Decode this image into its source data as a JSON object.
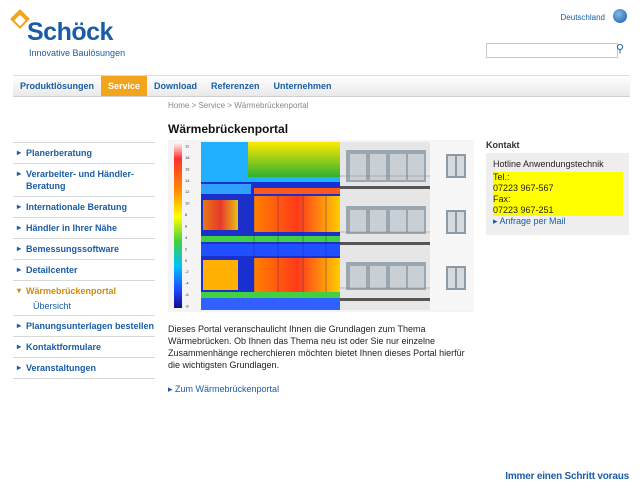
{
  "brand": {
    "name": "Schöck",
    "tagline": "Innovative Baulösungen",
    "accent": "#1a5da6",
    "orange": "#f2a51c"
  },
  "header": {
    "country": "Deutschland",
    "search_placeholder": ""
  },
  "nav": [
    "Produktlösungen",
    "Service",
    "Download",
    "Referenzen",
    "Unternehmen"
  ],
  "breadcrumb": "Home > Service > Wärmebrückenportal",
  "sidebar": {
    "items": [
      "Planerberatung",
      "Verarbeiter- und Händler-Beratung",
      "Internationale Beratung",
      "Händler in Ihrer Nähe",
      "Bemessungssoftware",
      "Detailcenter",
      "Wärmebrückenportal",
      "Planungsunterlagen bestellen",
      "Kontaktformulare",
      "Veranstaltungen"
    ],
    "sub": "Übersicht"
  },
  "main": {
    "title": "Wärmebrückenportal",
    "description": "Dieses Portal veranschaulicht Ihnen die Grundlagen zum Thema Wärmebrücken. Ob Ihnen das Thema neu ist oder Sie nur einzelne Zusammenhänge recherchieren möchten bietet Ihnen dieses Portal hierfür die wichtigsten Grundlagen.",
    "link": "Zum Wärmebrückenportal",
    "scale_ticks": [
      "11",
      "18",
      "16",
      "14",
      "12",
      "10",
      "8",
      "6",
      "4",
      "2",
      "0",
      "-2",
      "-4",
      "-6",
      "-8"
    ]
  },
  "contact": {
    "heading": "Kontakt",
    "hotline": "Hotline Anwendungstechnik",
    "tel_label": "Tel.:",
    "tel": "07223 967-567",
    "fax_label": "Fax:",
    "fax": "07223 967-251",
    "mail_link": "Anfrage per Mail"
  },
  "footer": {
    "slogan": "Immer einen Schritt voraus"
  }
}
